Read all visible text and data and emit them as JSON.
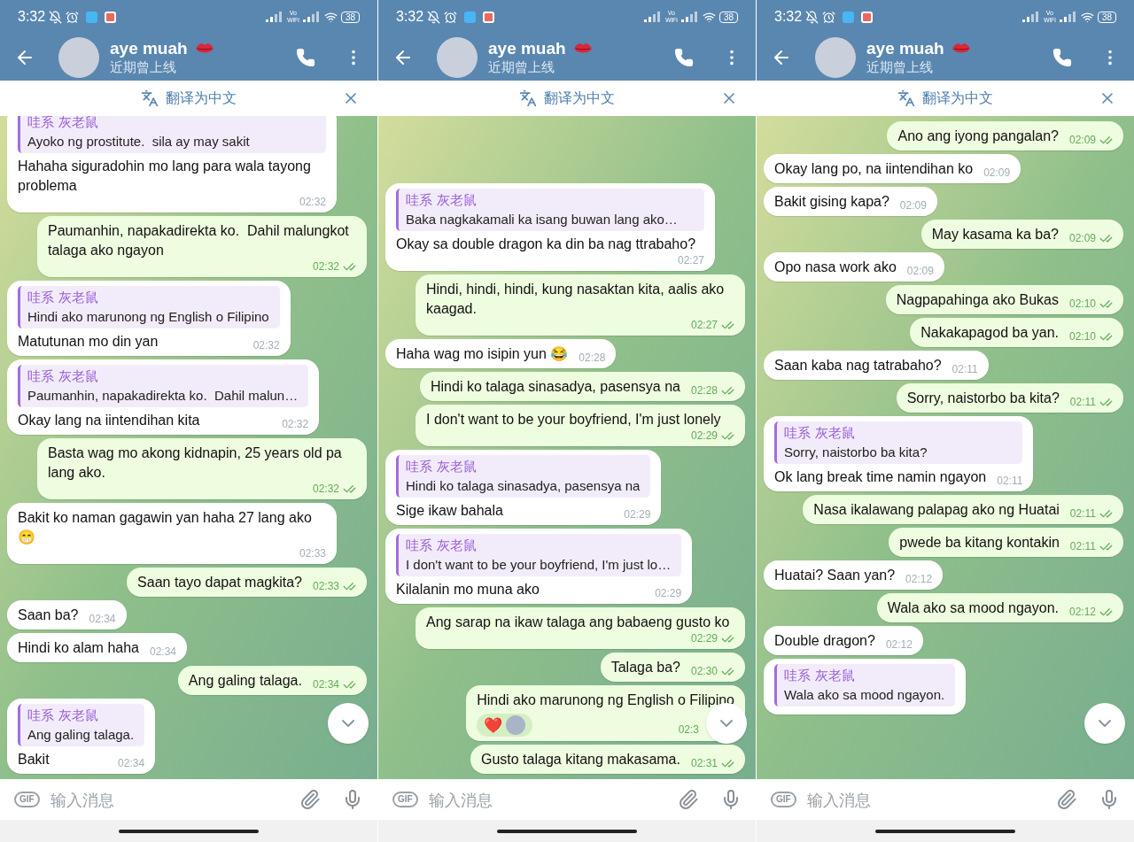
{
  "panels": [
    {
      "status_bar": {
        "time": "3:32",
        "network": "Vo WiFi",
        "battery": "38"
      },
      "header": {
        "name": "aye muah",
        "status": "近期曾上线"
      },
      "translate_bar": {
        "label": "翻译为中文"
      },
      "messages": [
        {
          "kind": "in",
          "reply": {
            "author": "哇系 灰老鼠",
            "text": "Ayoko ng prostitute.  sila ay may sakit"
          },
          "text": "Hahaha siguradohin mo lang para wala tayong problema",
          "time": "02:32"
        },
        {
          "kind": "out",
          "text": "Paumanhin, napakadirekta ko.  Dahil malungkot talaga ako ngayon",
          "time": "02:32",
          "read": true
        },
        {
          "kind": "in",
          "reply": {
            "author": "哇系 灰老鼠",
            "text": "Hindi ako marunong ng English o Filipino"
          },
          "text": "Matutunan mo din yan",
          "time": "02:32"
        },
        {
          "kind": "in",
          "reply": {
            "author": "哇系 灰老鼠",
            "text": "Paumanhin, napakadirekta ko.  Dahil malun…"
          },
          "text": "Okay lang na iintendihan kita",
          "time": "02:32"
        },
        {
          "kind": "out",
          "text": "Basta wag mo akong kidnapin, 25 years old pa lang ako.",
          "time": "02:32",
          "read": true
        },
        {
          "kind": "in",
          "text": "Bakit ko naman gagawin yan haha 27 lang ako 😁",
          "time": "02:33"
        },
        {
          "kind": "out",
          "text": "Saan tayo dapat magkita?",
          "time": "02:33",
          "read": true
        },
        {
          "kind": "in",
          "text": "Saan ba?",
          "time": "02:34"
        },
        {
          "kind": "in",
          "text": "Hindi ko alam haha",
          "time": "02:34"
        },
        {
          "kind": "out",
          "text": "Ang galing talaga.",
          "time": "02:34",
          "read": true
        },
        {
          "kind": "in",
          "reply": {
            "author": "哇系 灰老鼠",
            "text": "Ang galing talaga."
          },
          "text": "Bakit",
          "time": "02:34"
        }
      ],
      "input": {
        "gif": "GIF",
        "placeholder": "输入消息"
      }
    },
    {
      "status_bar": {
        "time": "3:32",
        "network": "Vo WiFi",
        "battery": "38"
      },
      "header": {
        "name": "aye muah",
        "status": "近期曾上线"
      },
      "translate_bar": {
        "label": "翻译为中文"
      },
      "messages": [
        {
          "kind": "in",
          "reply": {
            "author": "哇系 灰老鼠",
            "text": "Baka nagkakamali ka isang buwan lang ako…"
          },
          "text": "Okay sa double dragon ka din ba nag ttrabaho?",
          "time": "02:27"
        },
        {
          "kind": "out",
          "text": "Hindi, hindi, hindi, kung nasaktan kita, aalis ako kaagad.",
          "time": "02:27",
          "read": true
        },
        {
          "kind": "in",
          "text": "Haha wag mo isipin yun 😂",
          "time": "02:28"
        },
        {
          "kind": "out",
          "text": "Hindi ko talaga sinasadya, pasensya na",
          "time": "02:28",
          "read": true
        },
        {
          "kind": "out",
          "text": "I don't want to be your boyfriend, I'm just lonely",
          "time": "02:29",
          "read": true
        },
        {
          "kind": "in",
          "reply": {
            "author": "哇系 灰老鼠",
            "text": "Hindi ko talaga sinasadya, pasensya na"
          },
          "text": "Sige ikaw bahala",
          "time": "02:29"
        },
        {
          "kind": "in",
          "reply": {
            "author": "哇系 灰老鼠",
            "text": "I don't want to be your boyfriend, I'm just lo…"
          },
          "text": "Kilalanin mo muna ako",
          "time": "02:29"
        },
        {
          "kind": "out",
          "text": "Ang sarap na ikaw talaga ang babaeng gusto ko",
          "time": "02:29",
          "read": true
        },
        {
          "kind": "out",
          "text": "Talaga ba?",
          "time": "02:30",
          "read": true
        },
        {
          "kind": "out",
          "text": "Hindi ako marunong ng English o Filipino",
          "reactions": [
            "❤️"
          ],
          "time": "02:3"
        },
        {
          "kind": "out",
          "text": "Gusto talaga kitang makasama.",
          "time": "02:31",
          "read": true
        }
      ],
      "input": {
        "gif": "GIF",
        "placeholder": "输入消息"
      }
    },
    {
      "status_bar": {
        "time": "3:32",
        "network": "Vo WiFi",
        "battery": "38"
      },
      "header": {
        "name": "aye muah",
        "status": "近期曾上线"
      },
      "translate_bar": {
        "label": "翻译为中文"
      },
      "messages": [
        {
          "kind": "out",
          "text": "Ano ang iyong pangalan?",
          "time": "02:09",
          "read": true
        },
        {
          "kind": "in",
          "text": "Okay lang po, na iintendihan ko",
          "time": "02:09"
        },
        {
          "kind": "in",
          "text": "Bakit gising kapa?",
          "time": "02:09"
        },
        {
          "kind": "out",
          "text": "May kasama ka ba?",
          "time": "02:09",
          "read": true
        },
        {
          "kind": "in",
          "text": "Opo nasa work ako",
          "time": "02:09"
        },
        {
          "kind": "out",
          "text": "Nagpapahinga ako Bukas",
          "time": "02:10",
          "read": true
        },
        {
          "kind": "out",
          "text": "Nakakapagod ba yan.",
          "time": "02:10",
          "read": true
        },
        {
          "kind": "in",
          "text": "Saan kaba nag tatrabaho?",
          "time": "02:11"
        },
        {
          "kind": "out",
          "text": "Sorry, naistorbo ba kita?",
          "time": "02:11",
          "read": true
        },
        {
          "kind": "in",
          "reply": {
            "author": "哇系 灰老鼠",
            "text": "Sorry, naistorbo ba kita?"
          },
          "text": "Ok lang break time namin ngayon",
          "time": "02:11"
        },
        {
          "kind": "out",
          "text": "Nasa ikalawang palapag ako ng Huatai",
          "time": "02:11",
          "read": true
        },
        {
          "kind": "out",
          "text": "pwede ba kitang kontakin",
          "time": "02:11",
          "read": true
        },
        {
          "kind": "in",
          "text": "Huatai? Saan yan?",
          "time": "02:12"
        },
        {
          "kind": "out",
          "text": "Wala ako sa mood ngayon.",
          "time": "02:12",
          "read": true
        },
        {
          "kind": "in",
          "text": "Double dragon?",
          "time": "02:12"
        },
        {
          "kind": "in",
          "reply": {
            "author": "哇系 灰老鼠",
            "text": "Wala ako sa mood ngayon."
          }
        }
      ],
      "input": {
        "gif": "GIF",
        "placeholder": "输入消息"
      }
    }
  ]
}
